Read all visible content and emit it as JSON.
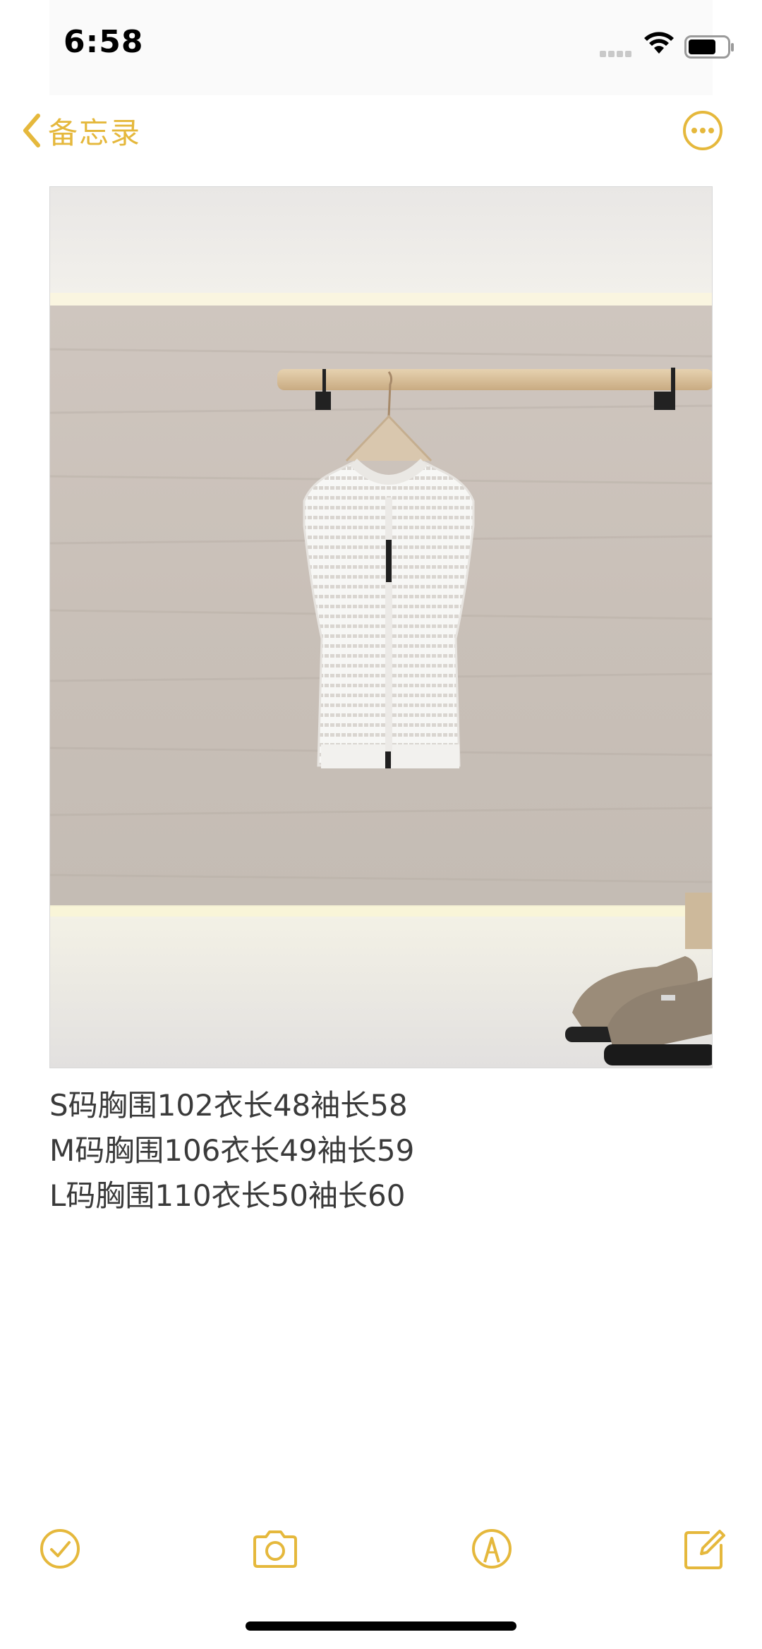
{
  "status_bar": {
    "time": "6:58"
  },
  "nav": {
    "back_label": "备忘录",
    "accent_color": "#e5b83c",
    "icons": {
      "back": "chevron-left-icon",
      "more": "ellipsis-circle-icon"
    }
  },
  "note": {
    "photo_alt": "photo",
    "lines": [
      "S码胸围102衣长48袖长58",
      "M码胸围106衣长49袖长59",
      "L码胸围110衣长50袖长60"
    ]
  },
  "toolbar": {
    "icons": [
      "checklist-icon",
      "camera-icon",
      "markup-icon",
      "compose-icon"
    ]
  }
}
